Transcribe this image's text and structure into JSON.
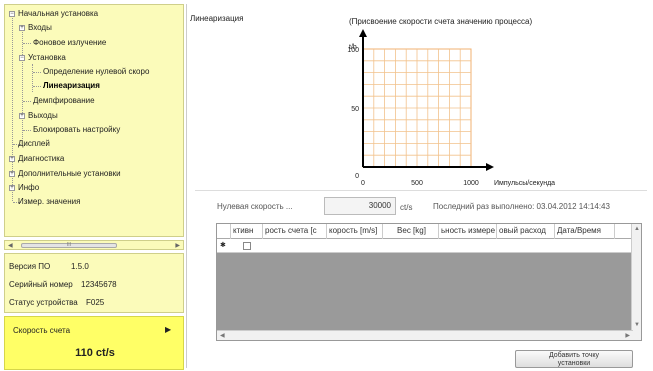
{
  "tree": {
    "items": [
      {
        "label": "Начальная установка",
        "expander": "−"
      },
      {
        "label": "Входы",
        "expander": "+"
      },
      {
        "label": "Фоновое излучение"
      },
      {
        "label": "Установка",
        "expander": "−"
      },
      {
        "label": "Определение нулевой скоро"
      },
      {
        "label": "Линеаризация",
        "selected": true
      },
      {
        "label": "Демпфирование"
      },
      {
        "label": "Выходы",
        "expander": "+"
      },
      {
        "label": "Блокировать настройку"
      },
      {
        "label": "Дисплей"
      },
      {
        "label": "Диагностика",
        "expander": "+"
      },
      {
        "label": "Дополнительные установки",
        "expander": "+"
      },
      {
        "label": "Инфо",
        "expander": "+"
      },
      {
        "label": "Измер. значения"
      }
    ]
  },
  "info": {
    "version_label": "Версия ПО",
    "version_value": "1.5.0",
    "serial_label": "Серийный номер",
    "serial_value": "12345678",
    "status_label": "Статус устройства",
    "status_value": "F025"
  },
  "count_panel": {
    "label": "Скорость счета",
    "value": "110 ct/s",
    "arrow": "▶"
  },
  "linearization": {
    "title": "Линеаризация",
    "chart_caption": "(Присвоение скорости счета значению процесса)"
  },
  "chart_data": {
    "type": "line",
    "ylabel": "t/h",
    "xlabel": "Импульсы/секунда",
    "xlim": [
      0,
      1000
    ],
    "ylim": [
      0,
      100
    ],
    "x_ticks": [
      "0",
      "500",
      "1000"
    ],
    "y_ticks": [
      "0",
      "50",
      "100"
    ],
    "grid": true,
    "series": []
  },
  "zero_rate": {
    "label": "Нулевая скорость ...",
    "value": "30000",
    "unit": "ct/s",
    "last_exec": "Последний раз выполнено: 03.04.2012 14:14:43"
  },
  "grid_table": {
    "columns": [
      "ктивн",
      "рость счета [c",
      "корость [m/s]",
      "Вес [kg]",
      "ьность измере",
      "овый расход",
      "Дата/Время"
    ],
    "row_marker": "✱"
  },
  "add_button": {
    "label_line1": "Добавить точку",
    "label_line2": "установки"
  },
  "colors": {
    "tree_bg": "#fbfbba",
    "count_bg": "#ffff66",
    "grid_line": "#f2c28c",
    "grid_empty": "#9a9a9a"
  }
}
